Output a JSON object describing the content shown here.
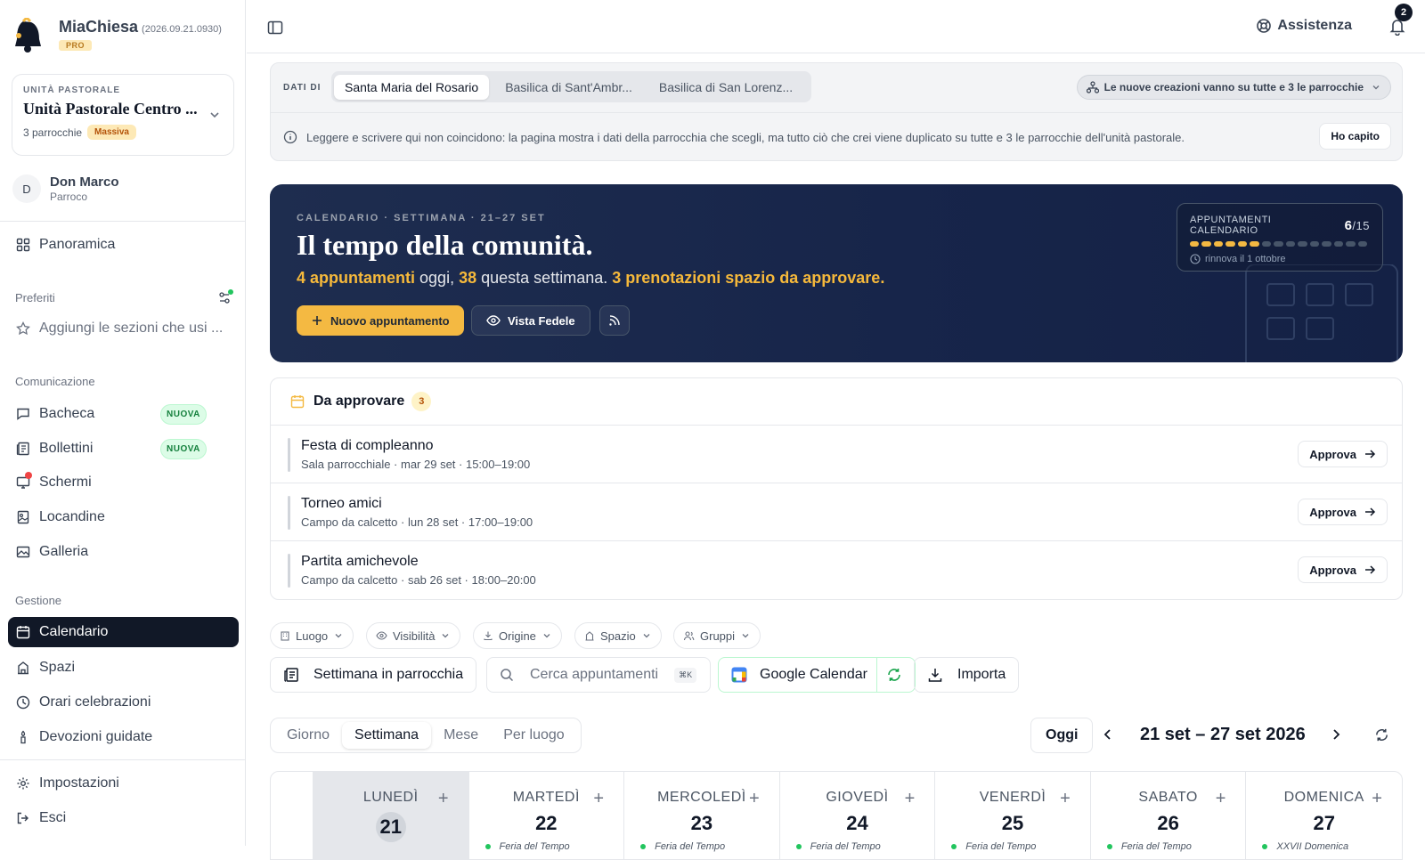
{
  "app": {
    "name": "MiaChiesa",
    "version": "(2026.09.21.0930)",
    "plan": "PRO"
  },
  "unit": {
    "label": "UNITÀ PASTORALE",
    "name": "Unità Pastorale Centro ...",
    "parishes": "3 parrocchie",
    "badge": "Massiva"
  },
  "user": {
    "initial": "D",
    "name": "Don Marco",
    "role": "Parroco"
  },
  "nav": {
    "overview": "Panoramica",
    "favorites": {
      "title": "Preferiti",
      "add": "Aggiungi le sezioni che usi ..."
    },
    "communication": {
      "title": "Comunicazione",
      "items": [
        {
          "label": "Bacheca",
          "badge": "NUOVA"
        },
        {
          "label": "Bollettini",
          "badge": "NUOVA"
        },
        {
          "label": "Schermi"
        },
        {
          "label": "Locandine"
        },
        {
          "label": "Galleria"
        }
      ]
    },
    "management": {
      "title": "Gestione",
      "items": [
        {
          "label": "Calendario"
        },
        {
          "label": "Spazi"
        },
        {
          "label": "Orari celebrazioni"
        },
        {
          "label": "Devozioni guidate"
        }
      ]
    },
    "settings": "Impostazioni",
    "logout": "Esci"
  },
  "topbar": {
    "help": "Assistenza",
    "notifications": "2"
  },
  "data_scope": {
    "label": "DATI DI",
    "tabs": [
      "Santa Maria del Rosario",
      "Basilica di Sant'Ambr...",
      "Basilica di San Lorenz..."
    ],
    "selected": "Santa Maria del Rosario",
    "creation_scope": "Le nuove creazioni vanno su tutte e 3 le parrocchie",
    "notice": "Leggere e scrivere qui non coincidono: la pagina mostra i dati della parrocchia che scegli, ma tutto ciò che crei viene duplicato su tutte e 3 le parrocchie dell'unità pastorale.",
    "dismiss": "Ho capito"
  },
  "hero": {
    "eyebrow": "CALENDARIO · SETTIMANA · 21–27 SET",
    "title": "Il tempo della comunità.",
    "today_count": "4 appuntamenti",
    "today_suffix": "oggi,",
    "week_count": "38",
    "week_suffix": "questa settimana.",
    "pending": "3 prenotazioni spazio da approvare.",
    "new_button": "Nuovo appuntamento",
    "public_view": "Vista Fedele",
    "quota": {
      "label": "APPUNTAMENTI CALENDARIO",
      "used": "6",
      "total": "/15",
      "used_value": 6,
      "total_value": 15,
      "renew": "rinnova il 1 ottobre"
    },
    "accent": "#f4b942"
  },
  "approvals": {
    "title": "Da approvare",
    "count": "3",
    "items": [
      {
        "title": "Festa di compleanno",
        "meta": "Sala parrocchiale · mar 29 set · 15:00–19:00",
        "action": "Approva"
      },
      {
        "title": "Torneo amici",
        "meta": "Campo da calcetto · lun 28 set · 17:00–19:00",
        "action": "Approva"
      },
      {
        "title": "Partita amichevole",
        "meta": "Campo da calcetto · sab 26 set · 18:00–20:00",
        "action": "Approva"
      }
    ]
  },
  "filters": [
    "Luogo",
    "Visibilità",
    "Origine",
    "Spazio",
    "Gruppi"
  ],
  "toolbar": {
    "week_in_parish": "Settimana in parrocchia",
    "search_placeholder": "Cerca appuntamenti",
    "search_shortcut": "⌘K",
    "google": "Google Calendar",
    "import": "Importa"
  },
  "views": {
    "tabs": [
      "Giorno",
      "Settimana",
      "Mese",
      "Per luogo"
    ],
    "selected": "Settimana",
    "today": "Oggi",
    "range": "21 set – 27 set 2026"
  },
  "week": [
    {
      "name": "LUNEDÌ",
      "num": "21",
      "today": true,
      "note": ""
    },
    {
      "name": "MARTEDÌ",
      "num": "22",
      "note": "Feria del Tempo"
    },
    {
      "name": "MERCOLEDÌ",
      "num": "23",
      "note": "Feria del Tempo"
    },
    {
      "name": "GIOVEDÌ",
      "num": "24",
      "note": "Feria del Tempo"
    },
    {
      "name": "VENERDÌ",
      "num": "25",
      "note": "Feria del Tempo"
    },
    {
      "name": "SABATO",
      "num": "26",
      "note": "Feria del Tempo"
    },
    {
      "name": "DOMENICA",
      "num": "27",
      "note": "XXVII Domenica"
    }
  ]
}
